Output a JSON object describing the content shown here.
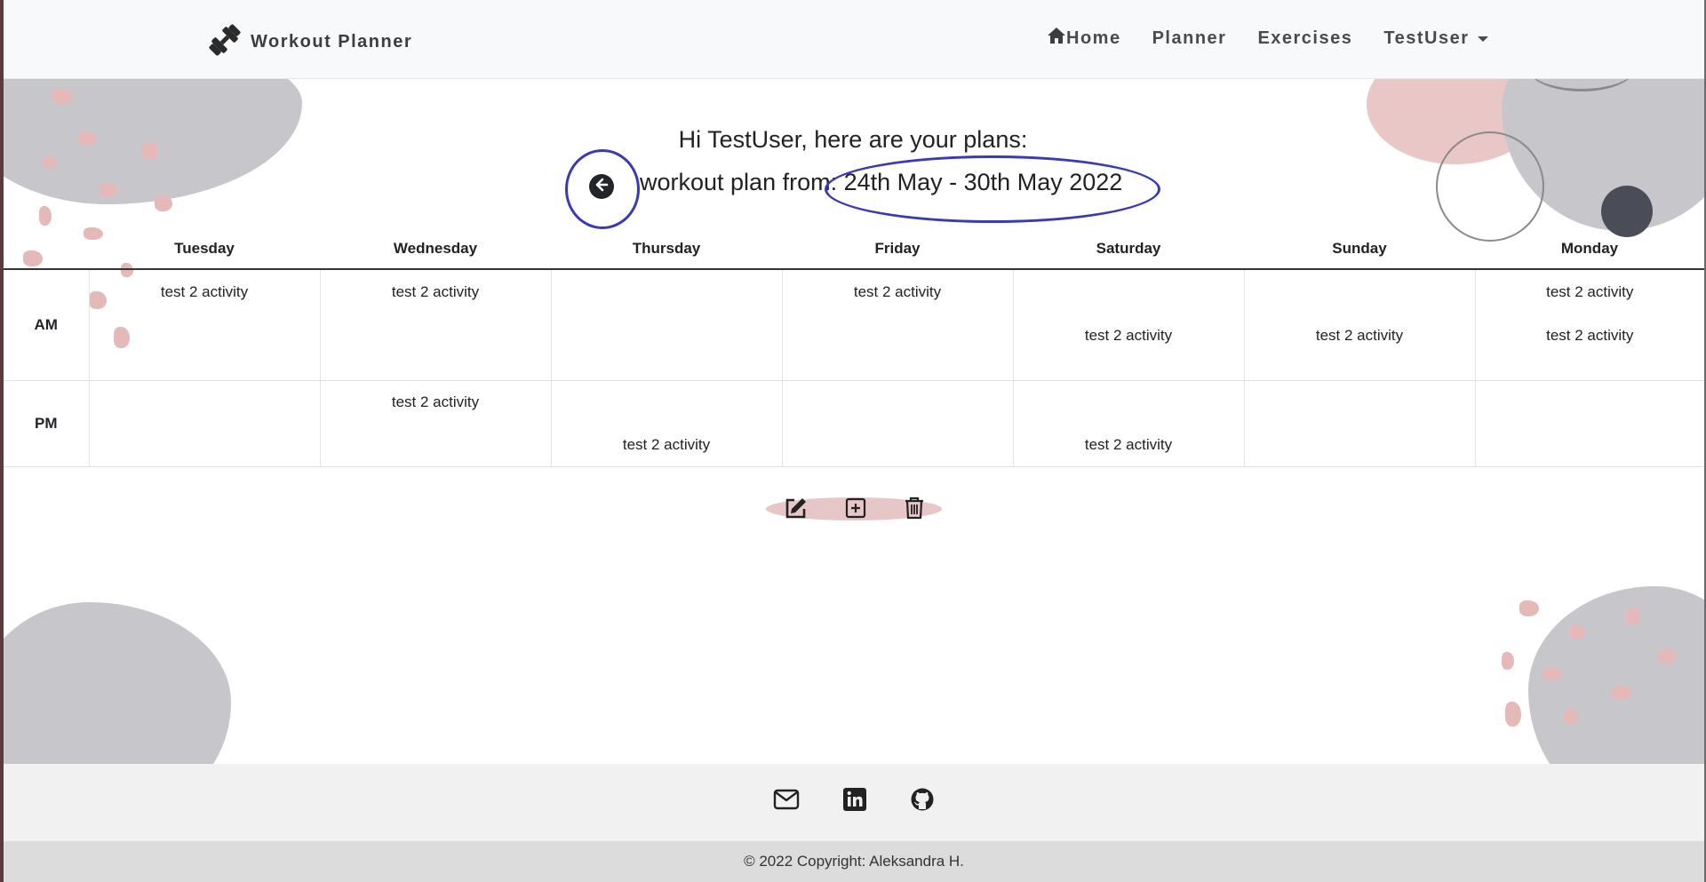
{
  "navbar": {
    "brand": "Workout Planner",
    "links": {
      "home": "Home",
      "planner": "Planner",
      "exercises": "Exercises",
      "user": "TestUser"
    }
  },
  "main": {
    "greeting": "Hi TestUser, here are your plans:",
    "plan_title": "workout plan from: 24th May - 30th May 2022"
  },
  "table": {
    "headers": [
      "",
      "Tuesday",
      "Wednesday",
      "Thursday",
      "Friday",
      "Saturday",
      "Sunday",
      "Monday"
    ],
    "rows": [
      {
        "label": "AM",
        "cells": [
          [
            "test 2 activity",
            ""
          ],
          [
            "test 2 activity",
            ""
          ],
          [
            "",
            ""
          ],
          [
            "test 2 activity",
            ""
          ],
          [
            "",
            "test 2 activity"
          ],
          [
            "",
            "test 2 activity"
          ],
          [
            "test 2 activity",
            "test 2 activity"
          ]
        ]
      },
      {
        "label": "PM",
        "cells": [
          [
            "",
            ""
          ],
          [
            "test 2 activity",
            ""
          ],
          [
            "",
            "test 2 activity"
          ],
          [
            "",
            ""
          ],
          [
            "",
            "test 2 activity"
          ],
          [
            "",
            ""
          ],
          [
            "",
            ""
          ]
        ]
      }
    ]
  },
  "toolbar": {
    "icons": [
      "edit-icon",
      "add-icon",
      "trash-icon"
    ]
  },
  "footer": {
    "icons": [
      "email-icon",
      "linkedin-icon",
      "github-icon"
    ],
    "copyright": "© 2022 Copyright: Aleksandra H."
  },
  "colors": {
    "annotation": "#3a3ab5",
    "navbar_bg": "#f8f9fa",
    "blob_gray": "#c6c6cb",
    "blob_pink": "#e9c7c7"
  }
}
